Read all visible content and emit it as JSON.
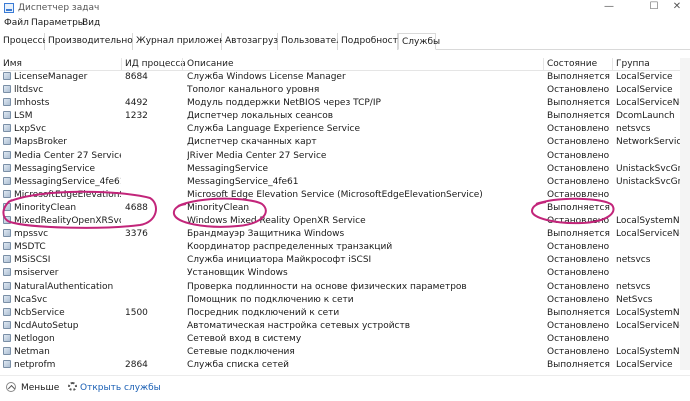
{
  "window": {
    "title": "Диспетчер задач"
  },
  "menu": [
    "Файл",
    "Параметры",
    "Вид"
  ],
  "tabs": [
    "Процессы",
    "Производительность",
    "Журнал приложений",
    "Автозагрузка",
    "Пользователи",
    "Подробности",
    "Службы"
  ],
  "active_tab_index": 6,
  "columns": {
    "name": "Имя",
    "pid": "ИД процесса",
    "desc": "Описание",
    "state": "Состояние",
    "group": "Группа"
  },
  "rows": [
    {
      "name": "LicenseManager",
      "pid": "8684",
      "desc": "Служба Windows License Manager",
      "state": "Выполняется",
      "group": "LocalService"
    },
    {
      "name": "lltdsvc",
      "pid": "",
      "desc": "Тополог канального уровня",
      "state": "Остановлено",
      "group": "LocalService"
    },
    {
      "name": "lmhosts",
      "pid": "4492",
      "desc": "Модуль поддержки NetBIOS через TCP/IP",
      "state": "Выполняется",
      "group": "LocalServiceNe..."
    },
    {
      "name": "LSM",
      "pid": "1232",
      "desc": "Диспетчер локальных сеансов",
      "state": "Выполняется",
      "group": "DcomLaunch"
    },
    {
      "name": "LxpSvc",
      "pid": "",
      "desc": "Служба Language Experience Service",
      "state": "Остановлено",
      "group": "netsvcs"
    },
    {
      "name": "MapsBroker",
      "pid": "",
      "desc": "Диспетчер скачанных карт",
      "state": "Остановлено",
      "group": "NetworkService"
    },
    {
      "name": "Media Center 27 Service",
      "pid": "",
      "desc": "JRiver Media Center 27 Service",
      "state": "Остановлено",
      "group": ""
    },
    {
      "name": "MessagingService",
      "pid": "",
      "desc": "MessagingService",
      "state": "Остановлено",
      "group": "UnistackSvcGro..."
    },
    {
      "name": "MessagingService_4fe61",
      "pid": "",
      "desc": "MessagingService_4fe61",
      "state": "Остановлено",
      "group": "UnistackSvcGro..."
    },
    {
      "name": "MicrosoftEdgeElevationServ...",
      "pid": "",
      "desc": "Microsoft Edge Elevation Service (MicrosoftEdgeElevationService)",
      "state": "Остановлено",
      "group": ""
    },
    {
      "name": "MinorityClean",
      "pid": "4688",
      "desc": "MinorityClean",
      "state": "Выполняется",
      "group": ""
    },
    {
      "name": "MixedRealityOpenXRSvc",
      "pid": "",
      "desc": "Windows Mixed Reality OpenXR Service",
      "state": "Остановлено",
      "group": "LocalSystemNe..."
    },
    {
      "name": "mpssvc",
      "pid": "3376",
      "desc": "Брандмауэр Защитника Windows",
      "state": "Выполняется",
      "group": "LocalServiceNo..."
    },
    {
      "name": "MSDTC",
      "pid": "",
      "desc": "Координатор распределенных транзакций",
      "state": "Остановлено",
      "group": ""
    },
    {
      "name": "MSiSCSI",
      "pid": "",
      "desc": "Служба инициатора Майкрософт iSCSI",
      "state": "Остановлено",
      "group": "netsvcs"
    },
    {
      "name": "msiserver",
      "pid": "",
      "desc": "Установщик Windows",
      "state": "Остановлено",
      "group": ""
    },
    {
      "name": "NaturalAuthentication",
      "pid": "",
      "desc": "Проверка подлинности на основе физических параметров",
      "state": "Остановлено",
      "group": "netsvcs"
    },
    {
      "name": "NcaSvc",
      "pid": "",
      "desc": "Помощник по подключению к сети",
      "state": "Остановлено",
      "group": "NetSvcs"
    },
    {
      "name": "NcbService",
      "pid": "1500",
      "desc": "Посредник подключений к сети",
      "state": "Выполняется",
      "group": "LocalSystemNe..."
    },
    {
      "name": "NcdAutoSetup",
      "pid": "",
      "desc": "Автоматическая настройка сетевых устройств",
      "state": "Остановлено",
      "group": "LocalServiceNo..."
    },
    {
      "name": "Netlogon",
      "pid": "",
      "desc": "Сетевой вход в систему",
      "state": "Остановлено",
      "group": ""
    },
    {
      "name": "Netman",
      "pid": "",
      "desc": "Сетевые подключения",
      "state": "Остановлено",
      "group": "LocalSystemNe..."
    },
    {
      "name": "netprofm",
      "pid": "2864",
      "desc": "Служба списка сетей",
      "state": "Выполняется",
      "group": "LocalService"
    }
  ],
  "footer": {
    "less_label": "Меньше",
    "open_services_label": "Открыть службы"
  },
  "annotation_color": "#c2257a"
}
